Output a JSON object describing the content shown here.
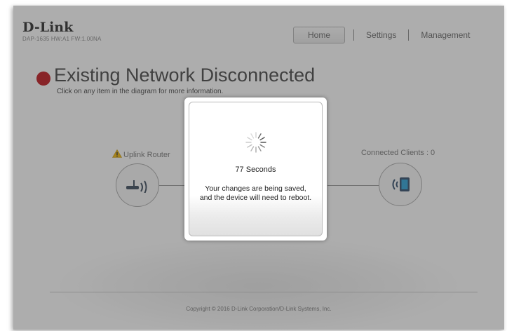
{
  "header": {
    "brand": "D-Link",
    "model_line": "DAP-1635   HW:A1   FW:1.00NA",
    "nav": {
      "home": "Home",
      "settings": "Settings",
      "management": "Management"
    }
  },
  "status": {
    "title": "Existing Network Disconnected",
    "subtitle": "Click on any item in the diagram for more information.",
    "color": "#c0131a"
  },
  "diagram": {
    "uplink_label": "Uplink Router",
    "clients_label": "Connected Clients : 0",
    "uplink_icon": "router-icon",
    "clients_icon": "wireless-client-icon",
    "warning_icon": "warning-icon"
  },
  "footer": {
    "copyright": "Copyright © 2016 D-Link Corporation/D-Link Systems, Inc."
  },
  "modal": {
    "countdown": "77 Seconds",
    "message_line1": "Your changes are being saved,",
    "message_line2": "and the device will need to reboot.",
    "spinner_icon": "spinner-icon"
  }
}
